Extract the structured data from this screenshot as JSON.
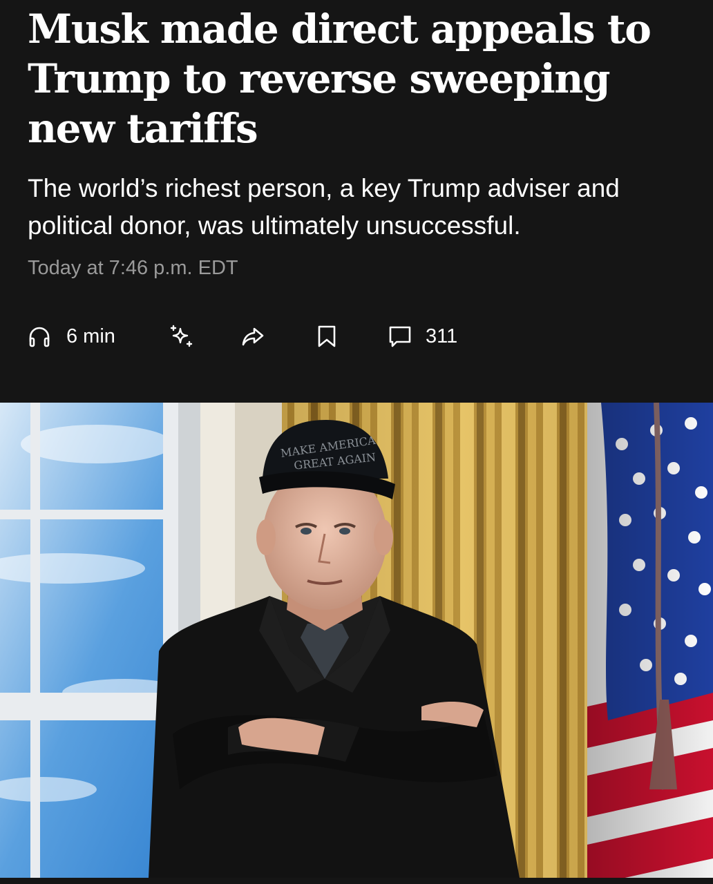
{
  "article": {
    "headline": "Musk made direct appeals to Trump to reverse sweeping new tariffs",
    "dek": "The world’s richest person, a key Trump adviser and political donor, was ultimately unsuccessful.",
    "timestamp": "Today at 7:46 p.m. EDT"
  },
  "actions": {
    "listen": {
      "icon": "headphones-icon",
      "label": "6 min"
    },
    "summary": {
      "icon": "sparkle-icon"
    },
    "share": {
      "icon": "share-icon"
    },
    "save": {
      "icon": "bookmark-icon"
    },
    "comments": {
      "icon": "comment-icon",
      "label": "311"
    }
  },
  "hero_image": {
    "hat_text_line1": "MAKE AMERICA",
    "hat_text_line2": "GREAT AGAIN"
  },
  "colors": {
    "background": "#151515",
    "text": "#ffffff",
    "muted_text": "#9a9a9a"
  }
}
